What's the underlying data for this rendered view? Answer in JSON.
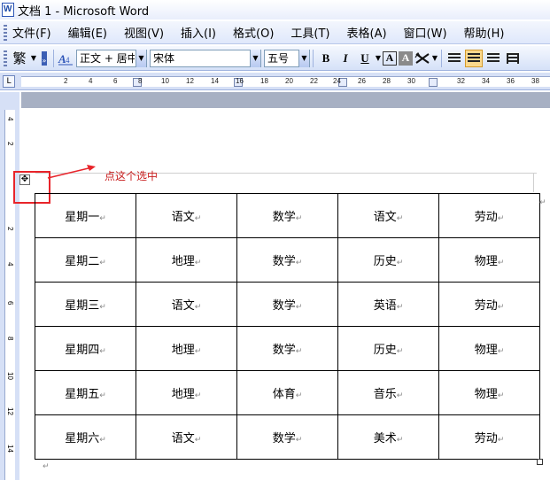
{
  "window": {
    "title": "文档 1 - Microsoft Word"
  },
  "menu": [
    "文件(F)",
    "编辑(E)",
    "视图(V)",
    "插入(I)",
    "格式(O)",
    "工具(T)",
    "表格(A)",
    "窗口(W)",
    "帮助(H)"
  ],
  "toolbar": {
    "traditional_btn": "繁",
    "style_combo": "正文 + 居中",
    "font_combo": "宋体",
    "size_combo": "五号",
    "bold": "B",
    "italic": "I",
    "underline": "U",
    "char_border": "A",
    "char_shading": "A"
  },
  "ruler": {
    "corner": "L",
    "h_ticks": [
      "2",
      "4",
      "6",
      "8",
      "10",
      "12",
      "14",
      "16",
      "18",
      "20",
      "22",
      "24",
      "26",
      "28",
      "30",
      "32",
      "34",
      "36",
      "38"
    ],
    "v_ticks": [
      "4",
      "2",
      "2",
      "4",
      "6",
      "8",
      "10",
      "12",
      "14"
    ]
  },
  "annotation": {
    "text": "点这个选中"
  },
  "table": {
    "rows": [
      [
        "星期一",
        "语文",
        "数学",
        "语文",
        "劳动"
      ],
      [
        "星期二",
        "地理",
        "数学",
        "历史",
        "物理"
      ],
      [
        "星期三",
        "语文",
        "数学",
        "英语",
        "劳动"
      ],
      [
        "星期四",
        "地理",
        "数学",
        "历史",
        "物理"
      ],
      [
        "星期五",
        "地理",
        "体育",
        "音乐",
        "物理"
      ],
      [
        "星期六",
        "语文",
        "数学",
        "美术",
        "劳动"
      ]
    ],
    "para_mark": "↵"
  },
  "colors": {
    "annotation_red": "#e8242a",
    "active_button": "#fbd98d"
  }
}
